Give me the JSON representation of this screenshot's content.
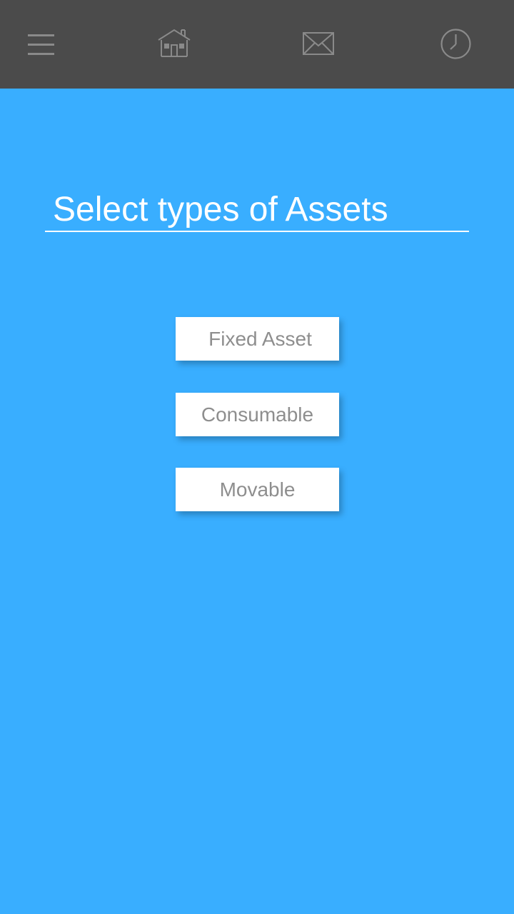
{
  "app_bar": {
    "background_color": "#4B4B4B",
    "icon_color": "#8A8A8A",
    "icons": [
      "hamburger-menu-icon",
      "home-icon",
      "mail-icon",
      "clock-icon"
    ]
  },
  "main": {
    "background_color": "#39AEFF",
    "title": "Select types of Assets",
    "asset_types": [
      {
        "label": "Fixed Asset"
      },
      {
        "label": "Consumable"
      },
      {
        "label": "Movable"
      }
    ]
  }
}
